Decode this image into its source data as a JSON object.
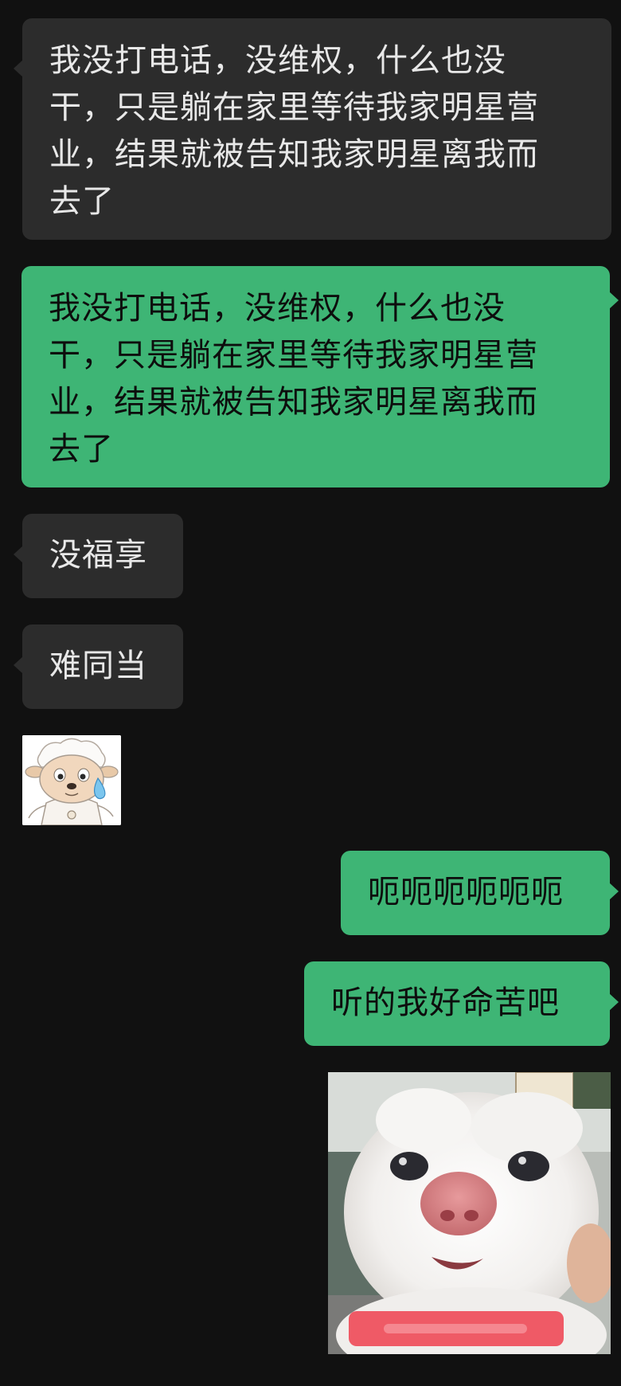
{
  "messages": [
    {
      "side": "in",
      "text_lines": [
        "我没打电话，没维权，什么也没",
        "干，只是躺在家里等待我家明星营",
        "业，结果就被告知我家明星离我而",
        "去了"
      ]
    },
    {
      "side": "out",
      "text_lines": [
        "我没打电话，没维权，什么也没",
        "干，只是躺在家里等待我家明星营",
        "业，结果就被告知我家明星离我而",
        "去了"
      ]
    },
    {
      "side": "in",
      "text": "没福享"
    },
    {
      "side": "in",
      "text": "难同当"
    },
    {
      "side": "in",
      "sticker": "crying-sheep-sticker"
    },
    {
      "side": "out",
      "text": "呃呃呃呃呃呃"
    },
    {
      "side": "out",
      "text": "听的我好命苦吧"
    },
    {
      "side": "out",
      "sticker": "white-kitten-sticker"
    }
  ],
  "colors": {
    "background": "#111111",
    "incoming_bubble": "#2c2c2c",
    "outgoing_bubble": "#3eb575",
    "incoming_text": "#e8e8e8",
    "outgoing_text": "#0d0d0d"
  }
}
